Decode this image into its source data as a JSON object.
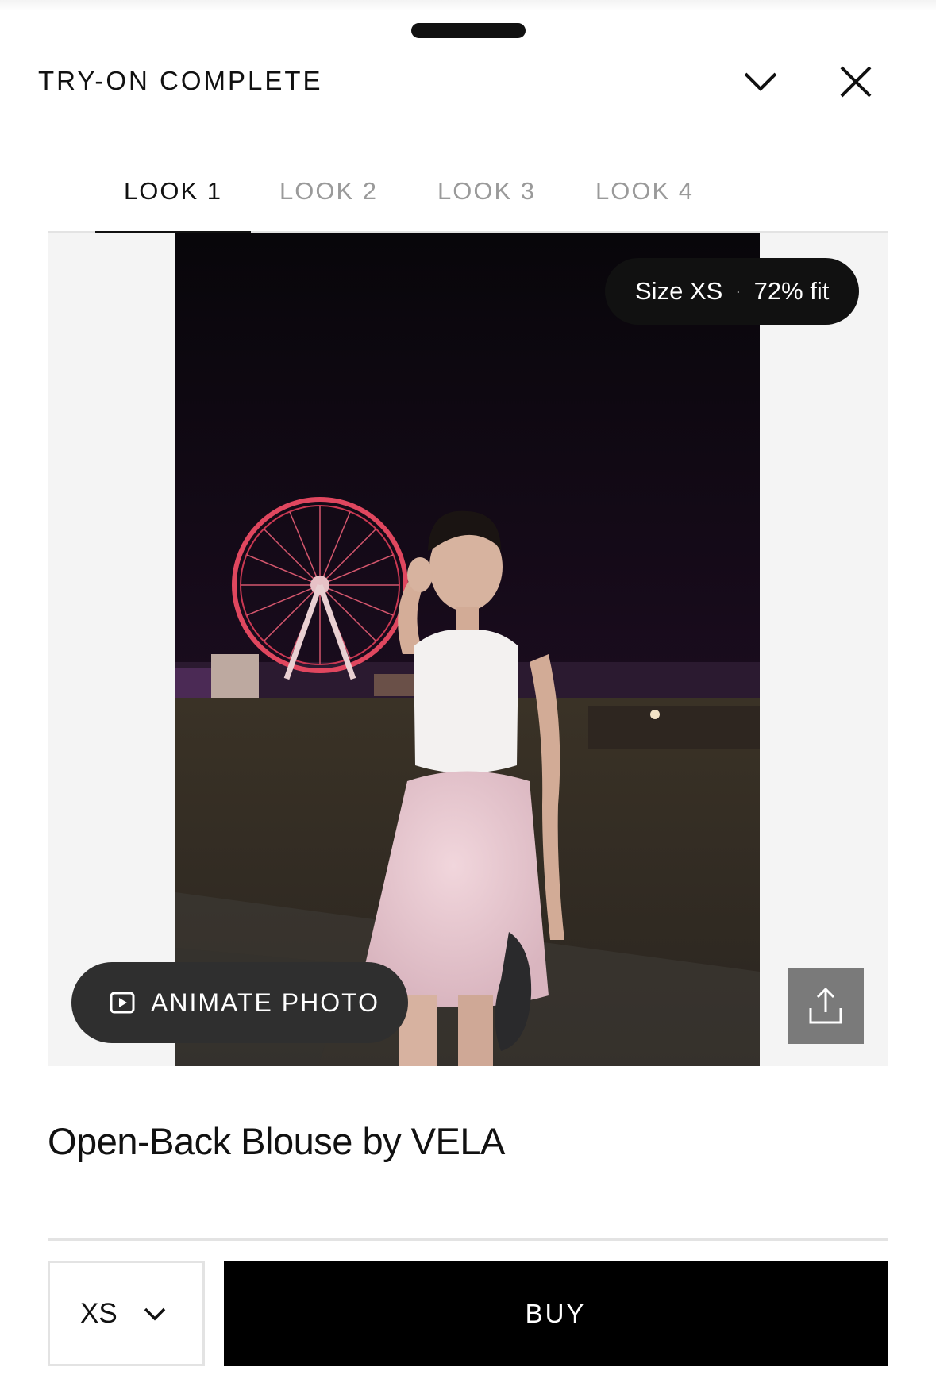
{
  "header": {
    "title": "TRY-ON COMPLETE",
    "collapse_icon": "chevron-down-icon",
    "close_icon": "close-icon"
  },
  "tabs": [
    {
      "label": "LOOK 1",
      "active": true
    },
    {
      "label": "LOOK 2",
      "active": false
    },
    {
      "label": "LOOK 3",
      "active": false
    },
    {
      "label": "LOOK 4",
      "active": false
    }
  ],
  "photo": {
    "size_badge": {
      "size": "Size XS",
      "separator": "·",
      "fit": "72% fit"
    },
    "animate_label": "ANIMATE PHOTO",
    "animate_icon": "play-square-icon",
    "share_icon": "share-icon"
  },
  "product": {
    "name": "Open-Back Blouse by VELA"
  },
  "footer": {
    "size_value": "XS",
    "size_icon": "chevron-down-icon",
    "buy_label": "BUY"
  },
  "colors": {
    "accent": "#000000",
    "stage_bg": "#f4f4f4",
    "pill_bg": "#111111",
    "animate_bg": "#2f2f2f",
    "share_bg": "#7a7a7a",
    "inactive_tab": "#9a9a9a"
  }
}
